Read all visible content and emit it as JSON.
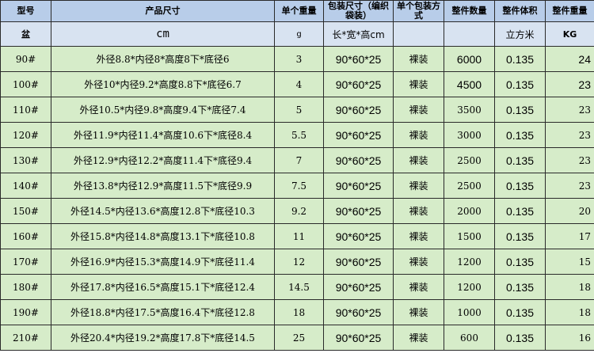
{
  "header": {
    "model": "型号",
    "size": "产品尺寸",
    "weight": "单个重量",
    "pack_size": "包装尺寸（编织袋装）",
    "pack_way": "单个包装方式",
    "qty": "整件数量",
    "volume": "整件体积",
    "gross": "整件重量"
  },
  "units": {
    "model": "盆",
    "size": "cm",
    "weight": "g",
    "pack_size": "长*宽*高cm",
    "pack_way": "",
    "qty": "",
    "volume": "立方米",
    "gross": "KG"
  },
  "rows": [
    {
      "model": "90#",
      "size": "外径8.8*内径8*高度8下*底径6",
      "weight": "3",
      "pack": "90*60*25",
      "way": "裸装",
      "qty": "6000",
      "vol": "0.135",
      "kg": "24"
    },
    {
      "model": "100#",
      "size": "外径10*内径9.2*高度8.8下*底径6.7",
      "weight": "4",
      "pack": "90*60*25",
      "way": "裸装",
      "qty": "4500",
      "vol": "0.135",
      "kg": "23"
    },
    {
      "model": "110#",
      "size": "外径10.5*内径9.8*高度9.4下*底径7.4",
      "weight": "5",
      "pack": "90*60*25",
      "way": "裸装",
      "qty": "3500",
      "vol": "0.135",
      "kg": "23"
    },
    {
      "model": "120#",
      "size": "外径11.9*内径11.4*高度10.6下*底径8.4",
      "weight": "5.5",
      "pack": "90*60*25",
      "way": "裸装",
      "qty": "3000",
      "vol": "0.135",
      "kg": "23"
    },
    {
      "model": "130#",
      "size": "外径12.9*内径12.2*高度11.4下*底径9.4",
      "weight": "7",
      "pack": "90*60*25",
      "way": "裸装",
      "qty": "2500",
      "vol": "0.135",
      "kg": "23"
    },
    {
      "model": "140#",
      "size": "外径13.8*内径12.9*高度11.5下*底径9.9",
      "weight": "7.5",
      "pack": "90*60*25",
      "way": "裸装",
      "qty": "2500",
      "vol": "0.135",
      "kg": "23"
    },
    {
      "model": "150#",
      "size": "外径14.5*内径13.6*高度12.8下*底径10.3",
      "weight": "9.2",
      "pack": "90*60*25",
      "way": "裸装",
      "qty": "2000",
      "vol": "0.135",
      "kg": "20"
    },
    {
      "model": "160#",
      "size": "外径15.8*内径14.8*高度13.1下*底径10.8",
      "weight": "11",
      "pack": "90*60*25",
      "way": "裸装",
      "qty": "1500",
      "vol": "0.135",
      "kg": "17"
    },
    {
      "model": "170#",
      "size": "外径16.9*内径15.3*高度14.9下*底径11.4",
      "weight": "12",
      "pack": "90*60*25",
      "way": "裸装",
      "qty": "1200",
      "vol": "0.135",
      "kg": "15"
    },
    {
      "model": "180#",
      "size": "外径17.8*内径16.5*高度15.1下*底径12.4",
      "weight": "14.5",
      "pack": "90*60*25",
      "way": "裸装",
      "qty": "1200",
      "vol": "0.135",
      "kg": "18"
    },
    {
      "model": "190#",
      "size": "外径18.8*内径17.5*高度16.4下*底径12.8",
      "weight": "18",
      "pack": "90*60*25",
      "way": "裸装",
      "qty": "1000",
      "vol": "0.135",
      "kg": "18"
    },
    {
      "model": "210#",
      "size": "外径20.4*内径19.2*高度17.8下*底径14.5",
      "weight": "25",
      "pack": "90*60*25",
      "way": "裸装",
      "qty": "600",
      "vol": "0.135",
      "kg": "16"
    }
  ],
  "colors": {
    "header_row_1": "#b8cde9",
    "header_row_2": "#d8e3f1",
    "body_rows": "#d6ecc9",
    "border": "#2a2a2a"
  }
}
